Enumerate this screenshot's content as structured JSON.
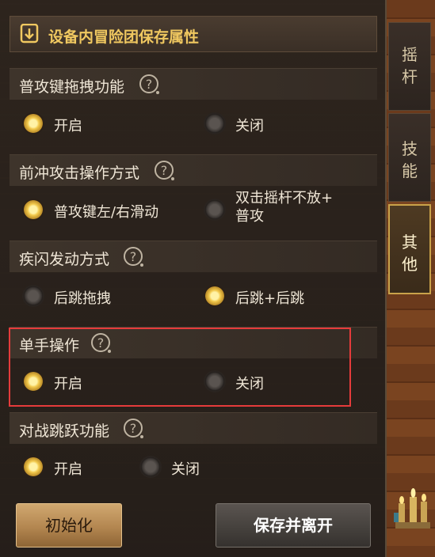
{
  "header": {
    "title": "设备内冒险团保存属性"
  },
  "tabs": [
    {
      "label": "摇杆",
      "chars": [
        "摇",
        "杆"
      ],
      "active": false
    },
    {
      "label": "技能",
      "chars": [
        "技",
        "能"
      ],
      "active": false
    },
    {
      "label": "其他",
      "chars": [
        "其",
        "他"
      ],
      "active": true
    }
  ],
  "sections": [
    {
      "title": "普攻键拖拽功能",
      "options": [
        {
          "label": "开启",
          "selected": true
        },
        {
          "label": "关闭",
          "selected": false
        }
      ]
    },
    {
      "title": "前冲攻击操作方式",
      "options": [
        {
          "label": "普攻键左/右滑动",
          "selected": true
        },
        {
          "label_line1": "双击摇杆不放+",
          "label_line2": "普攻",
          "selected": false
        }
      ]
    },
    {
      "title": "疾闪发动方式",
      "options": [
        {
          "label": "后跳拖拽",
          "selected": false
        },
        {
          "label": "后跳+后跳",
          "selected": true
        }
      ]
    },
    {
      "title": "单手操作",
      "options": [
        {
          "label": "开启",
          "selected": true
        },
        {
          "label": "关闭",
          "selected": false
        }
      ]
    },
    {
      "title": "对战跳跃功能",
      "options": [
        {
          "label": "开启",
          "selected": true
        },
        {
          "label": "关闭",
          "selected": false
        }
      ]
    }
  ],
  "buttons": {
    "reset": "初始化",
    "save": "保存并离开"
  },
  "colors": {
    "title_gold": "#f0c860",
    "radio_on": "#f2c94c",
    "highlight": "#e53b3b"
  }
}
